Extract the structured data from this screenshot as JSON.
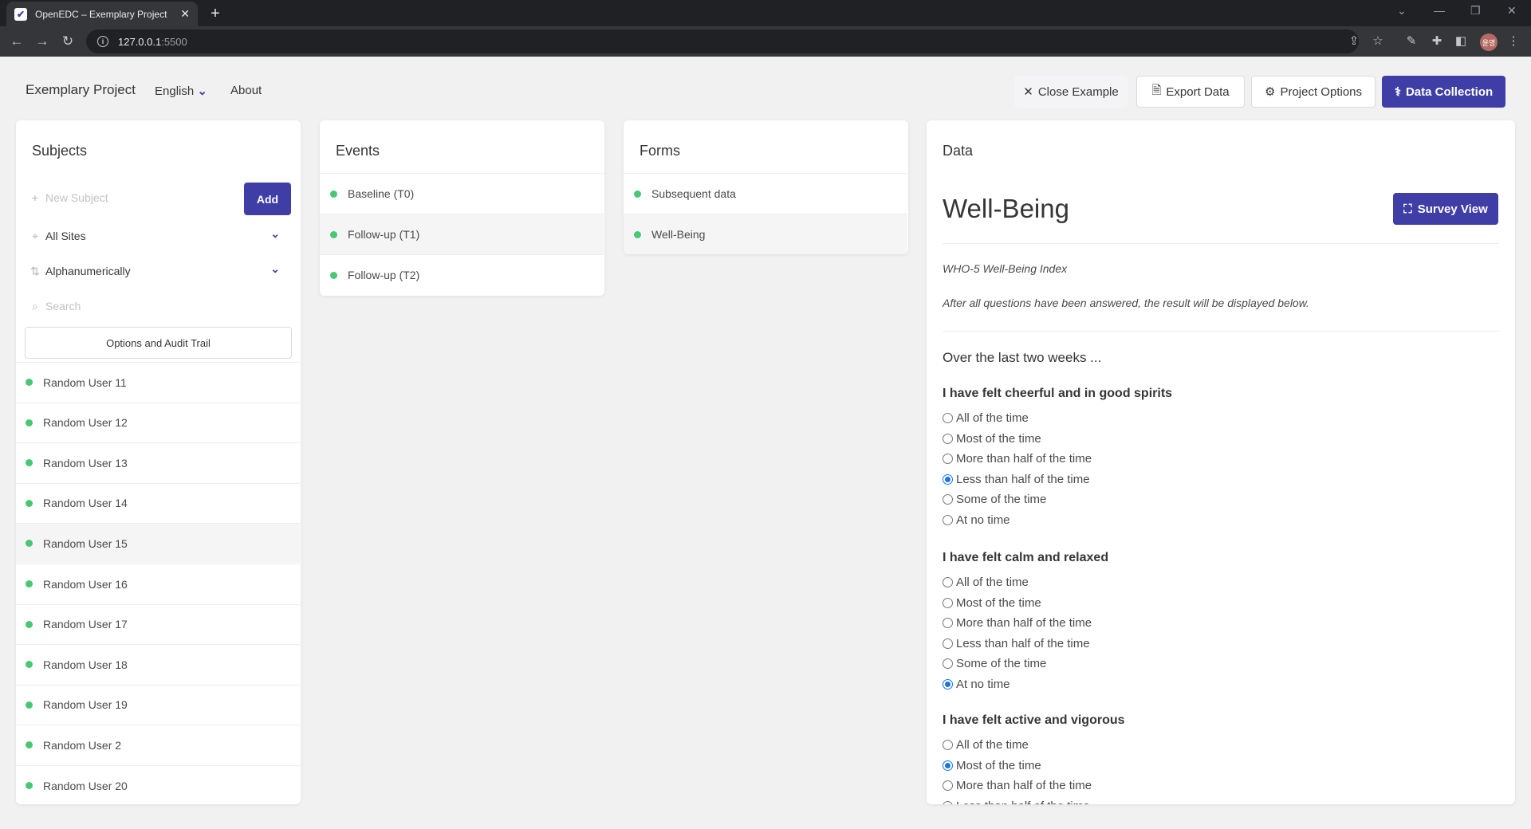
{
  "browser": {
    "tab_title": "OpenEDC – Exemplary Project",
    "url_host": "127.0.0.1",
    "url_port": ":5500",
    "profile_initials": "윤영"
  },
  "navbar": {
    "brand": "Exemplary Project",
    "language": "English",
    "about": "About",
    "close_example": "Close Example",
    "export_data": "Export Data",
    "project_options": "Project Options",
    "data_collection": "Data Collection"
  },
  "subjects": {
    "header": "Subjects",
    "new_subject_placeholder": "New Subject",
    "add_label": "Add",
    "site_filter": "All Sites",
    "sort_order": "Alphanumerically",
    "search_placeholder": "Search",
    "options_button": "Options and Audit Trail",
    "items": [
      {
        "label": "Random User 11",
        "active": false
      },
      {
        "label": "Random User 12",
        "active": false
      },
      {
        "label": "Random User 13",
        "active": false
      },
      {
        "label": "Random User 14",
        "active": false
      },
      {
        "label": "Random User 15",
        "active": true
      },
      {
        "label": "Random User 16",
        "active": false
      },
      {
        "label": "Random User 17",
        "active": false
      },
      {
        "label": "Random User 18",
        "active": false
      },
      {
        "label": "Random User 19",
        "active": false
      },
      {
        "label": "Random User 2",
        "active": false
      },
      {
        "label": "Random User 20",
        "active": false
      }
    ]
  },
  "events": {
    "header": "Events",
    "items": [
      {
        "label": "Baseline (T0)",
        "active": false
      },
      {
        "label": "Follow-up (T1)",
        "active": true
      },
      {
        "label": "Follow-up (T2)",
        "active": false
      }
    ]
  },
  "forms": {
    "header": "Forms",
    "items": [
      {
        "label": "Subsequent data",
        "active": false
      },
      {
        "label": "Well-Being",
        "active": true
      }
    ]
  },
  "data": {
    "header": "Data",
    "form_title": "Well-Being",
    "survey_view": "Survey View",
    "index_name": "WHO-5 Well-Being Index",
    "note": "After all questions have been answered, the result will be displayed below.",
    "intro": "Over the last two weeks ...",
    "questions": [
      {
        "text": "I have felt cheerful and in good spirits",
        "options": [
          "All of the time",
          "Most of the time",
          "More than half of the time",
          "Less than half of the time",
          "Some of the time",
          "At no time"
        ],
        "selected": 3
      },
      {
        "text": "I have felt calm and relaxed",
        "options": [
          "All of the time",
          "Most of the time",
          "More than half of the time",
          "Less than half of the time",
          "Some of the time",
          "At no time"
        ],
        "selected": 5
      },
      {
        "text": "I have felt active and vigorous",
        "options": [
          "All of the time",
          "Most of the time",
          "More than half of the time",
          "Less than half of the time"
        ],
        "selected": 1
      }
    ]
  },
  "colors": {
    "primary": "#3e3ea6",
    "status_green": "#48c774",
    "radio_blue": "#1a73e8"
  }
}
